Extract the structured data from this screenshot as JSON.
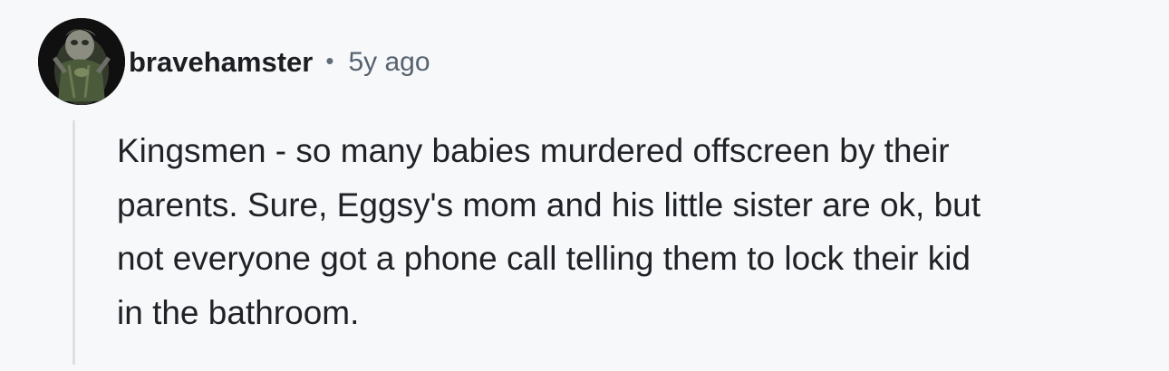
{
  "comment": {
    "author": "bravehamster",
    "separator": "•",
    "timestamp": "5y ago",
    "body_lines": [
      "Kingsmen - so many babies murdered offscreen by their",
      "parents. Sure, Eggsy's mom and his little sister are ok, but",
      "not everyone got a phone call telling them to lock their kid",
      "in the bathroom."
    ]
  },
  "colors": {
    "background": "#f7f8fa",
    "text": "#1f2226",
    "meta_text": "#56636f",
    "thread_line": "#dde1e5"
  }
}
